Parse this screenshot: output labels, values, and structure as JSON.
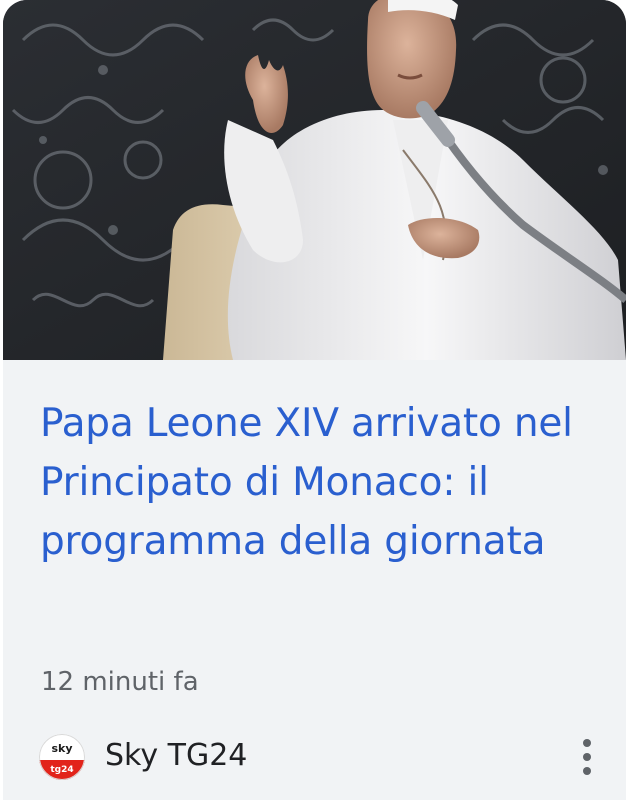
{
  "article": {
    "image_alt": "Papa Leone XIV benedice da un podio con microfono",
    "headline": "Papa Leone XIV arrivato nel Principato di Monaco: il programma della giornata",
    "timestamp": "12 minuti fa"
  },
  "source": {
    "name": "Sky TG24",
    "logo_icon": "sky-tg24-logo",
    "menu_icon": "more-vert-icon"
  },
  "colors": {
    "headline": "#2a5fcf",
    "card_background": "#f1f3f5",
    "timestamp": "#5f6368",
    "source_name": "#202124",
    "logo_red": "#e2231a"
  }
}
